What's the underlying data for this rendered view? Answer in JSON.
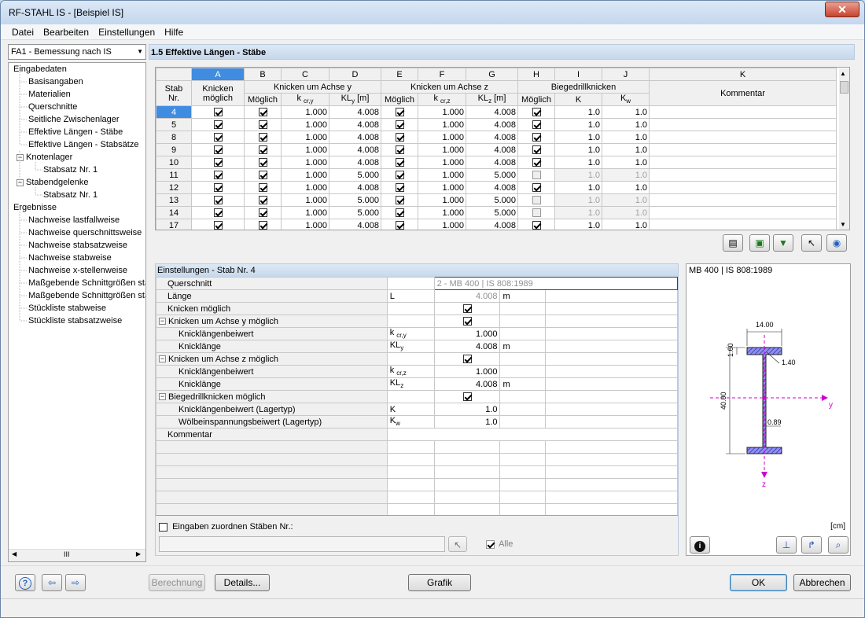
{
  "window": {
    "title": "RF-STAHL IS - [Beispiel IS]",
    "close": "✕"
  },
  "menu": [
    "Datei",
    "Bearbeiten",
    "Einstellungen",
    "Hilfe"
  ],
  "module_select": "FA1 - Bemessung nach IS",
  "nav": {
    "input_root": "Eingabedaten",
    "input_items": [
      "Basisangaben",
      "Materialien",
      "Querschnitte",
      "Seitliche Zwischenlager",
      "Effektive Längen - Stäbe",
      "Effektive Längen - Stabsätze"
    ],
    "knotenlager": "Knotenlager",
    "knotenlager_child": "Stabsatz Nr. 1",
    "stabendgelenke": "Stabendgelenke",
    "stabendgelenke_child": "Stabsatz Nr. 1",
    "results_root": "Ergebnisse",
    "result_items": [
      "Nachweise lastfallweise",
      "Nachweise querschnittsweise",
      "Nachweise stabsatzweise",
      "Nachweise stabweise",
      "Nachweise x-stellenweise",
      "Maßgebende Schnittgrößen sta",
      "Maßgebende Schnittgrößen sta",
      "Stückliste stabweise",
      "Stückliste stabsatzweise"
    ],
    "scroll_thumb": "III"
  },
  "section_title": "1.5 Effektive Längen - Stäbe",
  "grid": {
    "col_letters": [
      "A",
      "B",
      "C",
      "D",
      "E",
      "F",
      "G",
      "H",
      "I",
      "J",
      "K"
    ],
    "stab_label1": "Stab",
    "stab_label2": "Nr.",
    "groups": {
      "a1": "Knicken",
      "a2": "möglich",
      "y": "Knicken um Achse y",
      "z": "Knicken um Achse z",
      "lt": "Biegedrillknicken",
      "comment": "Kommentar"
    },
    "sub": {
      "b": "Möglich",
      "c_main": "k",
      "c_sub": "cr,y",
      "d_main": "KL",
      "d_sub": "y",
      "d_unit": " [m]",
      "e": "Möglich",
      "f_main": "k",
      "f_sub": "cr,z",
      "g_main": "KL",
      "g_sub": "z",
      "g_unit": " [m]",
      "h": "Möglich",
      "i": "K",
      "j_main": "K",
      "j_sub": "w"
    },
    "rows": [
      {
        "nr": "4",
        "a": true,
        "b": true,
        "c": "1.000",
        "d": "4.008",
        "e": true,
        "f": "1.000",
        "g": "4.008",
        "h": true,
        "i": "1.0",
        "j": "1.0",
        "dis": false
      },
      {
        "nr": "5",
        "a": true,
        "b": true,
        "c": "1.000",
        "d": "4.008",
        "e": true,
        "f": "1.000",
        "g": "4.008",
        "h": true,
        "i": "1.0",
        "j": "1.0",
        "dis": false
      },
      {
        "nr": "8",
        "a": true,
        "b": true,
        "c": "1.000",
        "d": "4.008",
        "e": true,
        "f": "1.000",
        "g": "4.008",
        "h": true,
        "i": "1.0",
        "j": "1.0",
        "dis": false
      },
      {
        "nr": "9",
        "a": true,
        "b": true,
        "c": "1.000",
        "d": "4.008",
        "e": true,
        "f": "1.000",
        "g": "4.008",
        "h": true,
        "i": "1.0",
        "j": "1.0",
        "dis": false
      },
      {
        "nr": "10",
        "a": true,
        "b": true,
        "c": "1.000",
        "d": "4.008",
        "e": true,
        "f": "1.000",
        "g": "4.008",
        "h": true,
        "i": "1.0",
        "j": "1.0",
        "dis": false
      },
      {
        "nr": "11",
        "a": true,
        "b": true,
        "c": "1.000",
        "d": "5.000",
        "e": true,
        "f": "1.000",
        "g": "5.000",
        "h": false,
        "i": "1.0",
        "j": "1.0",
        "dis": true
      },
      {
        "nr": "12",
        "a": true,
        "b": true,
        "c": "1.000",
        "d": "4.008",
        "e": true,
        "f": "1.000",
        "g": "4.008",
        "h": true,
        "i": "1.0",
        "j": "1.0",
        "dis": false
      },
      {
        "nr": "13",
        "a": true,
        "b": true,
        "c": "1.000",
        "d": "5.000",
        "e": true,
        "f": "1.000",
        "g": "5.000",
        "h": false,
        "i": "1.0",
        "j": "1.0",
        "dis": true
      },
      {
        "nr": "14",
        "a": true,
        "b": true,
        "c": "1.000",
        "d": "5.000",
        "e": true,
        "f": "1.000",
        "g": "5.000",
        "h": false,
        "i": "1.0",
        "j": "1.0",
        "dis": true
      },
      {
        "nr": "17",
        "a": true,
        "b": true,
        "c": "1.000",
        "d": "4.008",
        "e": true,
        "f": "1.000",
        "g": "4.008",
        "h": true,
        "i": "1.0",
        "j": "1.0",
        "dis": false
      }
    ]
  },
  "settings": {
    "title": "Einstellungen - Stab Nr. 4",
    "querschnitt_label": "Querschnitt",
    "querschnitt_value": "2 - MB 400 | IS 808:1989",
    "laenge_label": "Länge",
    "laenge_sym": "L",
    "laenge_value": "4.008",
    "laenge_unit": "m",
    "knicken_label": "Knicken möglich",
    "y_group": "Knicken um Achse y möglich",
    "y_k_label": "Knicklängenbeiwert",
    "y_k_sym_main": "k",
    "y_k_sym_sub": "cr,y",
    "y_k_value": "1.000",
    "y_l_label": "Knicklänge",
    "y_l_sym_main": "KL",
    "y_l_sym_sub": "y",
    "y_l_value": "4.008",
    "y_l_unit": "m",
    "z_group": "Knicken um Achse z möglich",
    "z_k_label": "Knicklängenbeiwert",
    "z_k_sym_main": "k",
    "z_k_sym_sub": "cr,z",
    "z_k_value": "1.000",
    "z_l_label": "Knicklänge",
    "z_l_sym_main": "KL",
    "z_l_sym_sub": "z",
    "z_l_value": "4.008",
    "z_l_unit": "m",
    "lt_group": "Biegedrillknicken möglich",
    "lt_k_label": "Knicklängenbeiwert (Lagertyp)",
    "lt_k_sym": "K",
    "lt_k_value": "1.0",
    "lt_w_label": "Wölbeinspannungsbeiwert (Lagertyp)",
    "lt_w_sym_main": "K",
    "lt_w_sym_sub": "w",
    "lt_w_value": "1.0",
    "kommentar_label": "Kommentar",
    "assign_label": "Eingaben zuordnen Stäben Nr.:",
    "alle_label": "Alle"
  },
  "preview": {
    "title": "MB 400 | IS 808:1989",
    "dim_width": "14.00",
    "dim_height": "40.00",
    "dim_tf": "1.60",
    "dim_r": "1.40",
    "dim_tw": "0.89",
    "axis_y": "y",
    "axis_z": "z",
    "unit": "[cm]"
  },
  "buttons": {
    "berechnung": "Berechnung",
    "details": "Details...",
    "grafik": "Grafik",
    "ok": "OK",
    "abbrechen": "Abbrechen"
  },
  "colors": {
    "accent": "#3f8ce0",
    "header": "#c6d8ec",
    "section_hatch": "#5a5ad0",
    "axis": "#d000d0"
  }
}
